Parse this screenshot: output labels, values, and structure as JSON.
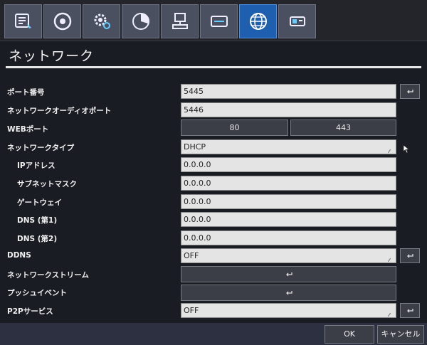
{
  "tabs": [
    {
      "icon": "system-info-icon"
    },
    {
      "icon": "record-disc-icon"
    },
    {
      "icon": "settings-gear-icon"
    },
    {
      "icon": "pie-chart-icon"
    },
    {
      "icon": "network-computer-icon"
    },
    {
      "icon": "display-icon"
    },
    {
      "icon": "globe-icon",
      "active": true
    },
    {
      "icon": "storage-device-icon"
    }
  ],
  "page": {
    "title": "ネットワーク"
  },
  "form": {
    "port_label": "ポート番号",
    "port_value": "5445",
    "audio_port_label": "ネットワークオーディオポート",
    "audio_port_value": "5446",
    "web_port_label": "WEBポート",
    "web_port_http": "80",
    "web_port_https": "443",
    "network_type_label": "ネットワークタイプ",
    "network_type_value": "DHCP",
    "ip_label": "IPアドレス",
    "ip_value": "0.0.0.0",
    "subnet_label": "サブネットマスク",
    "subnet_value": "0.0.0.0",
    "gateway_label": "ゲートウェイ",
    "gateway_value": "0.0.0.0",
    "dns1_label": "DNS (第1)",
    "dns1_value": "0.0.0.0",
    "dns2_label": "DNS (第2)",
    "dns2_value": "0.0.0.0",
    "ddns_label": "DDNS",
    "ddns_value": "OFF",
    "stream_label": "ネットワークストリーム",
    "push_label": "プッシュイベント",
    "p2p_label": "P2Pサービス",
    "p2p_value": "OFF"
  },
  "footer": {
    "ok_label": "OK",
    "cancel_label": "キャンセル"
  },
  "colors": {
    "active_tab": "#1f5fb0",
    "tab": "#4a5060",
    "field": "#e4e4e4",
    "background": "#1a1c23"
  }
}
